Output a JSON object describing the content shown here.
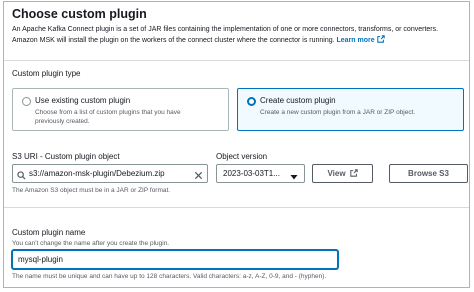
{
  "panel": {
    "title": "Choose custom plugin",
    "description_line1": "An Apache Kafka Connect plugin is a set of JAR files containing the implementation of one or more connectors, transforms, or converters.",
    "description_line2": "Amazon MSK will install the plugin on the workers of the connect cluster where the connector is running.",
    "learn_more": "Learn more"
  },
  "plugin_type": {
    "label": "Custom plugin type",
    "options": [
      {
        "title": "Use existing custom plugin",
        "desc_line1": "Choose from a list of custom plugins that you have",
        "desc_line2": "previously created.",
        "selected": false
      },
      {
        "title": "Create custom plugin",
        "desc_line1": "Create a new custom plugin from a JAR or ZIP object.",
        "desc_line2": "",
        "selected": true
      }
    ]
  },
  "s3": {
    "label": "S3 URI - Custom plugin object",
    "value": "s3://amazon-msk-plugin/Debezium.zip",
    "hint": "The Amazon S3 object must be in a JAR or ZIP format."
  },
  "object_version": {
    "label": "Object version",
    "value": "2023-03-03T1...",
    "view_label": "View",
    "browse_label": "Browse S3"
  },
  "plugin_name": {
    "label": "Custom plugin name",
    "hint": "You can't change the name after you create the plugin.",
    "value": "mysql-plugin",
    "constraint": "The name must be unique and can have up to 128 characters. Valid characters: a-z, A-Z, 0-9, and - (hyphen)."
  },
  "colors": {
    "accent": "#0073bb",
    "selected_bg": "#f1faff",
    "border": "#aab7b8"
  },
  "icons": [
    "external-link-icon",
    "search-icon",
    "clear-icon",
    "caret-down-icon"
  ]
}
